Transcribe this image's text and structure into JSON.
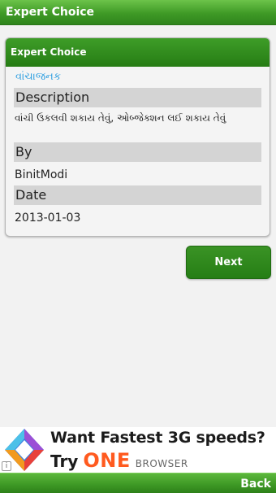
{
  "titlebar": {
    "title": "Expert Choice"
  },
  "card": {
    "header": "Expert Choice",
    "word": "વાંચાજનક",
    "description_label": "Description",
    "description_value": "વાંચી ઉકલવી શકાય તેવું, ઓબ્જેક્શન લઈ શકાય તેવું",
    "by_label": "By",
    "by_value": "BinitModi",
    "date_label": "Date",
    "date_value": "2013-01-03"
  },
  "next_button": {
    "label": "Next"
  },
  "ad": {
    "headline": "Want Fastest 3G speeds?",
    "try": "Try",
    "brand": "ONE",
    "product": "BROWSER",
    "info_glyph": "i",
    "logo_icon": "uc-browser-diamond-logo",
    "brand_color": "#ff5a1f"
  },
  "bottombar": {
    "back_label": "Back"
  },
  "colors": {
    "accent_green": "#3f9a26",
    "link_blue": "#2d9ee0",
    "label_gray": "#d4d4d4"
  }
}
